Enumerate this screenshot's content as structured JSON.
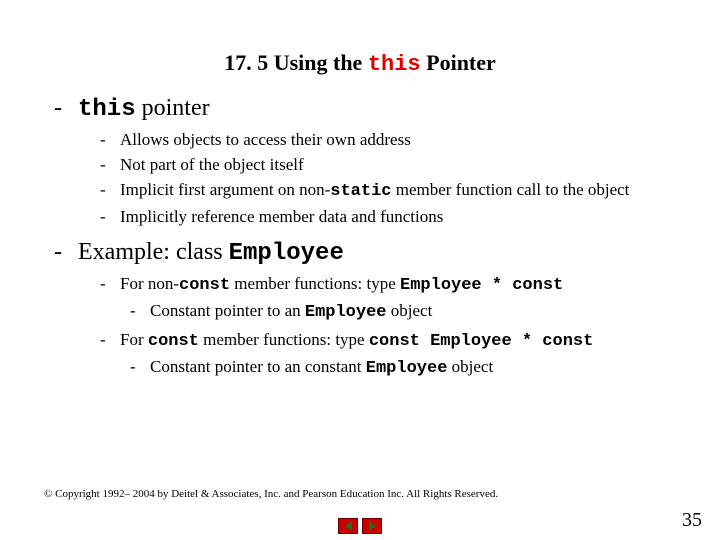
{
  "title": {
    "prefix": "17. 5  Using the ",
    "keyword": "this",
    "suffix": " Pointer"
  },
  "main": [
    {
      "text_parts": {
        "kw": "this",
        "rest": " pointer"
      },
      "sub": [
        {
          "text": "Allows objects to access their own address"
        },
        {
          "text": "Not part of the object itself"
        },
        {
          "pre": "Implicit first argument on non-",
          "kw": "static",
          "post": " member function call to the object"
        },
        {
          "text": "Implicitly reference member data and functions"
        }
      ]
    },
    {
      "text_parts": {
        "pre": "Example: class ",
        "kw": "Employee"
      },
      "sub": [
        {
          "pre": "For non-",
          "kw1": "const",
          "mid": " member functions: type ",
          "kw2": "Employee * const",
          "subsub": [
            {
              "pre": "Constant pointer to an ",
              "kw": "Employee",
              "post": " object"
            }
          ]
        },
        {
          "pre": "For ",
          "kw1": "const",
          "mid": " member functions: type ",
          "kw2": "const Employee * const",
          "subsub": [
            {
              "pre": "Constant pointer to an constant ",
              "kw": "Employee",
              "post": " object"
            }
          ]
        }
      ]
    }
  ],
  "copyright": "© Copyright 1992– 2004 by Deitel & Associates, Inc. and Pearson Education Inc. All Rights Reserved.",
  "page_number": "35",
  "nav": {
    "prev": "prev-slide",
    "next": "next-slide"
  }
}
